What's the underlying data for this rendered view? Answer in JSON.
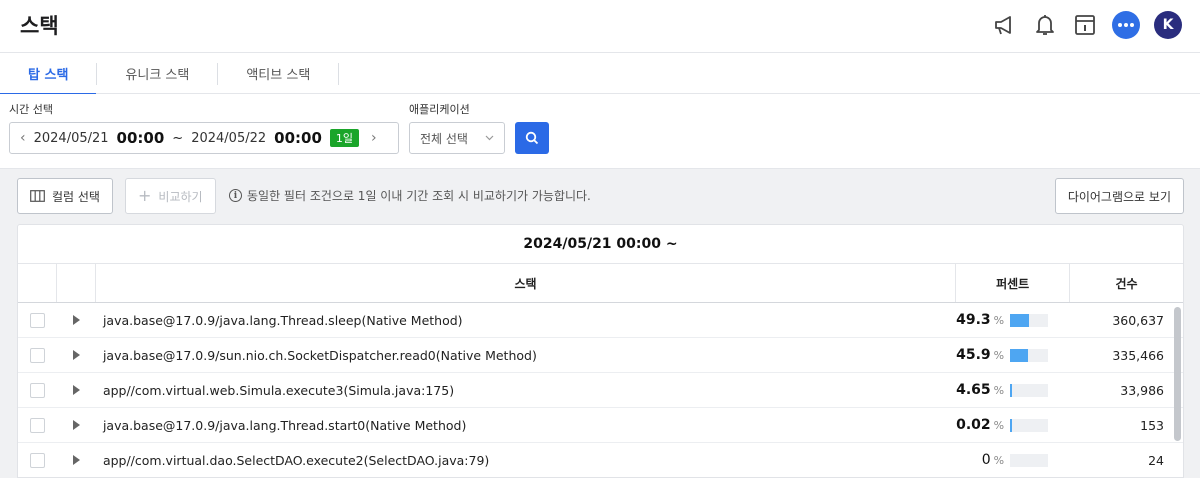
{
  "header": {
    "title": "스택"
  },
  "tabs": [
    {
      "label": "탑 스택",
      "active": true
    },
    {
      "label": "유니크 스택",
      "active": false
    },
    {
      "label": "액티브 스택",
      "active": false
    }
  ],
  "avatar_letter": "K",
  "filters": {
    "time_label": "시간 선택",
    "start_date": "2024/05/21",
    "start_time": "00:00",
    "range_sep": "~",
    "end_date": "2024/05/22",
    "end_time": "00:00",
    "duration_badge": "1일",
    "app_label": "애플리케이션",
    "app_value": "전체 선택"
  },
  "toolbar": {
    "column_select": "컬럼 선택",
    "compare": "비교하기",
    "note": "동일한 필터 조건으로 1일 이내 기간 조회 시 비교하기가 가능합니다.",
    "diagram_view": "다이어그램으로 보기"
  },
  "table": {
    "title": "2024/05/21 00:00 ~",
    "columns": {
      "stack": "스택",
      "percent": "퍼센트",
      "count": "건수"
    },
    "percent_unit": "%",
    "rows": [
      {
        "stack": "java.base@17.0.9/java.lang.Thread.sleep(Native Method)",
        "percent": "49.3",
        "pct_num": 49.3,
        "count": "360,637"
      },
      {
        "stack": "java.base@17.0.9/sun.nio.ch.SocketDispatcher.read0(Native Method)",
        "percent": "45.9",
        "pct_num": 45.9,
        "count": "335,466"
      },
      {
        "stack": "app//com.virtual.web.Simula.execute3(Simula.java:175)",
        "percent": "4.65",
        "pct_num": 4.65,
        "count": "33,986"
      },
      {
        "stack": "java.base@17.0.9/java.lang.Thread.start0(Native Method)",
        "percent": "0.02",
        "pct_num": 0.02,
        "count": "153"
      },
      {
        "stack": "app//com.virtual.dao.SelectDAO.execute2(SelectDAO.java:79)",
        "percent": "0",
        "pct_num": 0,
        "count": "24"
      }
    ]
  },
  "colors": {
    "accent": "#2b6ae6",
    "bar": "#4ea6f2",
    "badge": "#1aa52a"
  }
}
